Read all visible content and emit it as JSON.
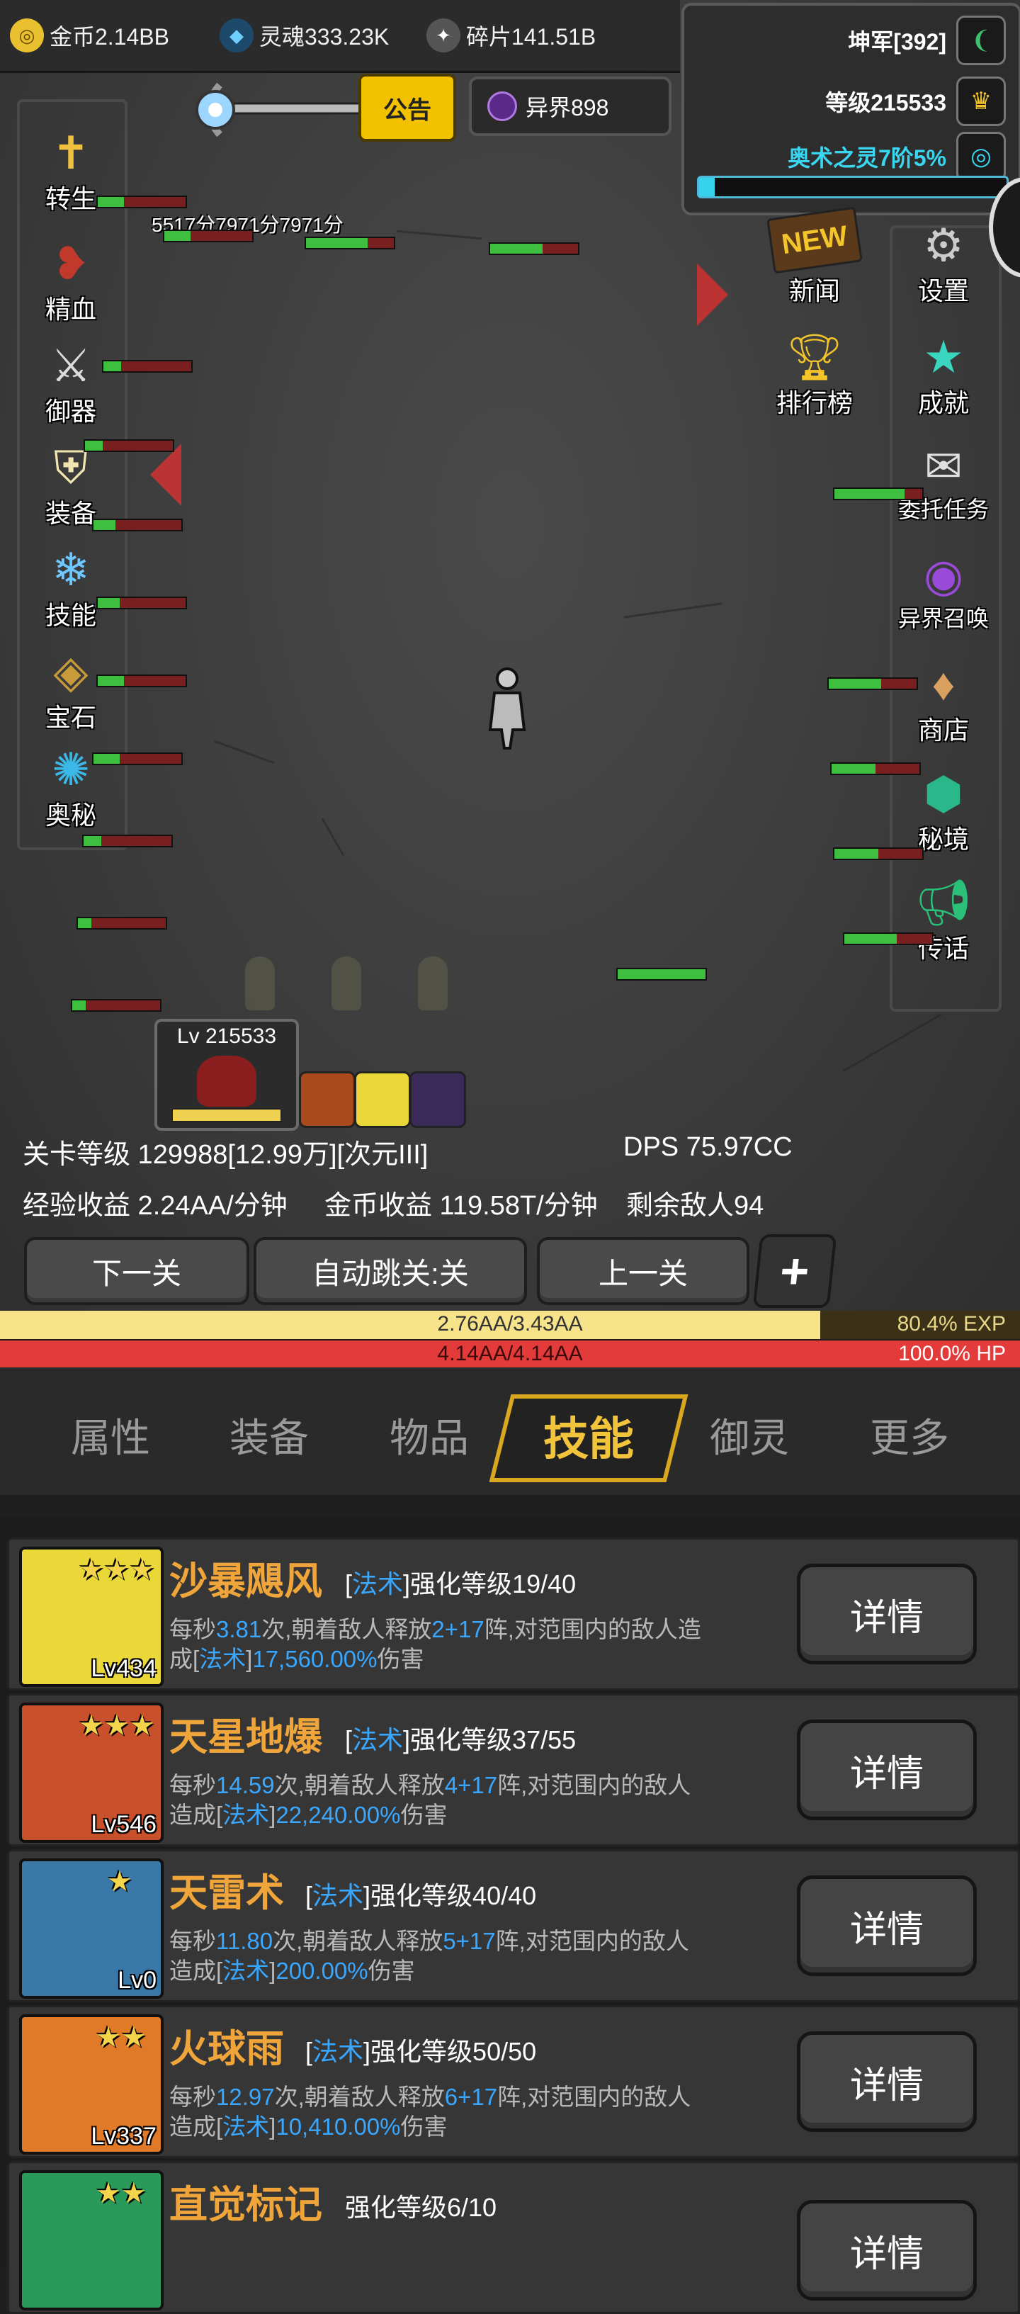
{
  "currencies": [
    {
      "icon": "gold-coin-icon",
      "label": "金币2.14BB",
      "color": "#e8c030"
    },
    {
      "icon": "soul-icon",
      "label": "灵魂333.23K",
      "color": "#4fb8f0"
    },
    {
      "icon": "shard-icon",
      "label": "碎片141.51B",
      "color": "#d0d0d0"
    }
  ],
  "player": {
    "rank": "坤军[392]",
    "level": "等级215533",
    "arcane": "奥术之灵7阶5%",
    "arcane_progress": 0.05
  },
  "notice_label": "公告",
  "otherworld_label": "异界898",
  "left_menu": [
    "转生",
    "精血",
    "御器",
    "装备",
    "技能",
    "宝石",
    "奥秘"
  ],
  "right_menu": [
    "新闻",
    "设置",
    "排行榜",
    "成就",
    "委托任务",
    "异界召唤",
    "商店",
    "秘境",
    "传话"
  ],
  "new_badge": "NEW",
  "float_text": "5517分7971分7971分",
  "avatar_level": "Lv 215533",
  "stage": {
    "level_text": "关卡等级 129988[12.99万][次元III]",
    "dps_text": "DPS 75.97CC",
    "exp_text": "经验收益 2.24AA/分钟",
    "gold_text": "金币收益 119.58T/分钟",
    "enemies_text": "剩余敌人94"
  },
  "buttons": {
    "next": "下一关",
    "auto": "自动跳关:关",
    "prev": "上一关",
    "plus": "+"
  },
  "exp_bar": {
    "value": "2.76AA/3.43AA",
    "pct": "80.4% EXP",
    "fraction": 0.804
  },
  "hp_bar": {
    "value": "4.14AA/4.14AA",
    "pct": "100.0%  HP",
    "fraction": 1.0
  },
  "tabs": [
    "属性",
    "装备",
    "物品",
    "技能",
    "御灵",
    "更多"
  ],
  "active_tab": "技能",
  "skills": [
    {
      "name": "沙暴飓风",
      "type": "法术",
      "enh": "强化等级19/40",
      "lv": "Lv434",
      "stars": "★★★",
      "d1": "每秒",
      "v1": "3.81",
      "d2": "次,朝着敌人释放",
      "v2": "2+17",
      "d3": "阵,对范围内的敌人造",
      "d4": "成[",
      "t": "法术",
      "d5": "]",
      "v3": "17,560.00%",
      "d6": "伤害",
      "color": "#e9d838"
    },
    {
      "name": "天星地爆",
      "type": "法术",
      "enh": "强化等级37/55",
      "lv": "Lv546",
      "stars": "★★★",
      "d1": "每秒",
      "v1": "14.59",
      "d2": "次,朝着敌人释放",
      "v2": "4+17",
      "d3": "阵,对范围内的敌人",
      "d4": "造成[",
      "t": "法术",
      "d5": "]",
      "v3": "22,240.00%",
      "d6": "伤害",
      "color": "#c8502a"
    },
    {
      "name": "天雷术",
      "type": "法术",
      "enh": "强化等级40/40",
      "lv": "Lv0",
      "stars": "★",
      "d1": "每秒",
      "v1": "11.80",
      "d2": "次,朝着敌人释放",
      "v2": "5+17",
      "d3": "阵,对范围内的敌人",
      "d4": "造成[",
      "t": "法术",
      "d5": "]",
      "v3": "200.00%",
      "d6": "伤害",
      "color": "#3a78a8"
    },
    {
      "name": "火球雨",
      "type": "法术",
      "enh": "强化等级50/50",
      "lv": "Lv337",
      "stars": "★★",
      "d1": "每秒",
      "v1": "12.97",
      "d2": "次,朝着敌人释放",
      "v2": "6+17",
      "d3": "阵,对范围内的敌人",
      "d4": "造成[",
      "t": "法术",
      "d5": "]",
      "v3": "10,410.00%",
      "d6": "伤害",
      "color": "#e07a28"
    },
    {
      "name": "直觉标记",
      "type": "",
      "enh": "强化等级6/10",
      "lv": "",
      "stars": "★★",
      "d1": "",
      "v1": "",
      "d2": "",
      "v2": "",
      "d3": "",
      "d4": "",
      "t": "",
      "d5": "",
      "v3": "",
      "d6": "",
      "color": "#2a9a5a"
    }
  ],
  "detail_label": "详情"
}
